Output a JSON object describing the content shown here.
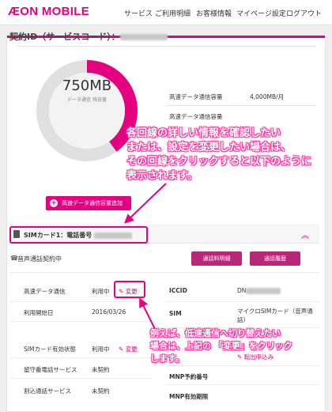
{
  "header": {
    "logo": "ÆON MOBILE",
    "nav": [
      "サービス",
      "ご利用明細",
      "お客様情報",
      "マイページ設定",
      "ログアウト"
    ]
  },
  "contract": {
    "label": "契約ID（サービスコード）："
  },
  "usage": {
    "value": "750MB",
    "sub": "データ通信 残容量",
    "fraction_used": 0.4,
    "rows": [
      {
        "label": "高速データ通信容量",
        "value": "4,000MB/月"
      },
      {
        "label": "高速データ通信容量",
        "value": ""
      }
    ]
  },
  "add_button": {
    "label": "高速データ通信容量追加"
  },
  "sim": {
    "title": "SIMカード1：電話番号",
    "voice": "音声通話契約中",
    "btn_detail": "通話料明細",
    "btn_history": "通話履歴"
  },
  "left_rows": [
    {
      "label": "高速データ通信",
      "value": "利用中",
      "change": "変更"
    },
    {
      "label": "利用開始日",
      "value": "2016/03/26",
      "change": ""
    },
    {
      "label": "SIMカード有効状態",
      "value": "利用中",
      "change": "変更"
    },
    {
      "label": "留守番電話サービス",
      "value": "未契約",
      "change": ""
    },
    {
      "label": "割込通話サービス",
      "value": "未契約",
      "change": ""
    }
  ],
  "right_rows": [
    {
      "label": "ICCID",
      "value": "DN"
    },
    {
      "label": "SIM",
      "value": "マイクロSIMカード（音声通話）"
    },
    {
      "label": "",
      "value": "転出申込み"
    },
    {
      "label": "MNP予約番号",
      "value": ""
    },
    {
      "label": "MNP有効期限",
      "value": ""
    }
  ],
  "annotation1": [
    "各回線の詳しい情報を確認したい",
    "または、設定を変更したい場合は、",
    "その回線をクリックすると以下のように",
    "表示されます。"
  ],
  "annotation2": [
    "例えば、低速通信へ切り替えたい",
    "場合は、上記の 「変更」をクリック",
    "します。"
  ],
  "colors": {
    "accent": "#e4007f",
    "button": "#b8277a",
    "annotation_outline": "#ff2f9f"
  }
}
